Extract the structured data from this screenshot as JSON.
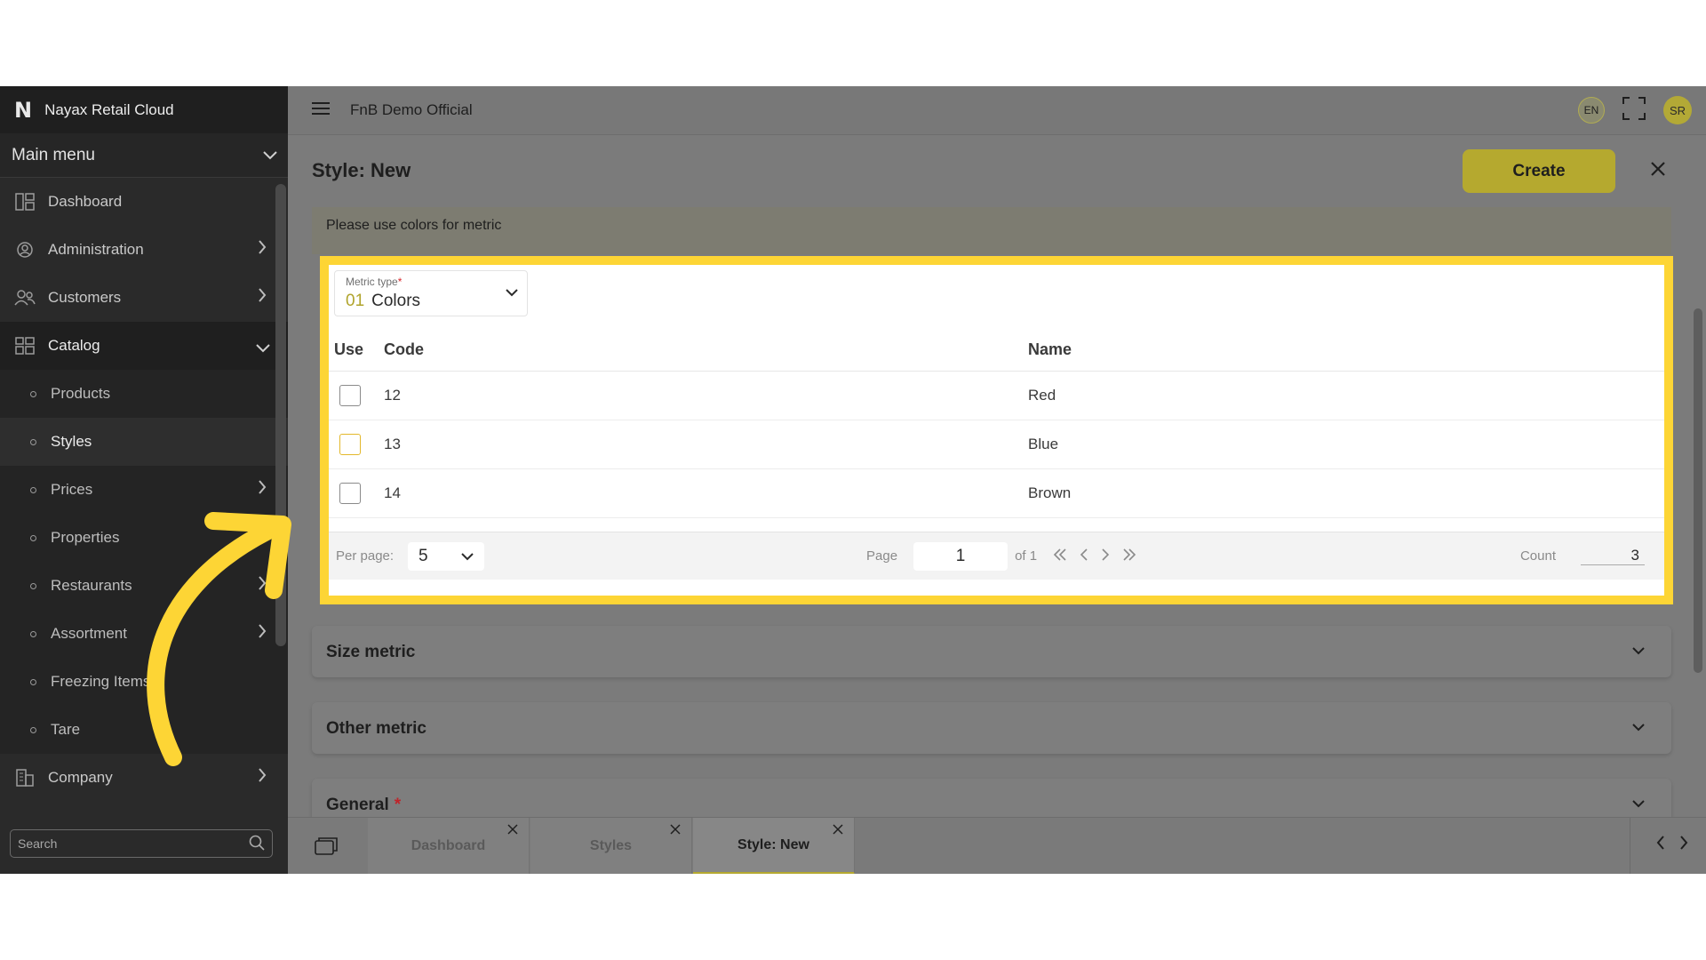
{
  "app": {
    "brand_logo": "N",
    "brand_name": "Nayax Retail Cloud",
    "workspace": "FnB Demo Official",
    "language": "EN",
    "user_initials": "SR"
  },
  "sidebar": {
    "main_menu_label": "Main menu",
    "items": [
      {
        "label": "Dashboard",
        "icon": "dashboard-icon"
      },
      {
        "label": "Administration",
        "icon": "gear-user-icon"
      },
      {
        "label": "Customers",
        "icon": "users-icon"
      },
      {
        "label": "Catalog",
        "icon": "grid-icon"
      }
    ],
    "catalog_sub": [
      "Products",
      "Styles",
      "Prices",
      "Properties",
      "Restaurants",
      "Assortment",
      "Freezing Items",
      "Tare"
    ],
    "company_label": "Company",
    "search_placeholder": "Search"
  },
  "page": {
    "title": "Style: New",
    "create_label": "Create",
    "info_text": "Please use colors for metric"
  },
  "metric": {
    "label": "Metric type",
    "required_mark": "*",
    "code": "01",
    "value": "Colors"
  },
  "table": {
    "headers": {
      "use": "Use",
      "code": "Code",
      "name": "Name"
    },
    "rows": [
      {
        "code": "12",
        "name": "Red"
      },
      {
        "code": "13",
        "name": "Blue"
      },
      {
        "code": "14",
        "name": "Brown"
      }
    ]
  },
  "pager": {
    "per_page_label": "Per page:",
    "per_page_value": "5",
    "page_label": "Page",
    "page_value": "1",
    "of_label": "of 1",
    "count_label": "Count",
    "count_value": "3"
  },
  "sections": {
    "size": "Size metric",
    "other": "Other metric",
    "general": "General",
    "required_mark": "*"
  },
  "tabs": [
    "Dashboard",
    "Styles",
    "Style: New"
  ],
  "colors": {
    "accent": "#b5a92f",
    "highlight": "#fdd535",
    "sidebar_bg": "#2a2a2a",
    "required": "#d8262b"
  }
}
